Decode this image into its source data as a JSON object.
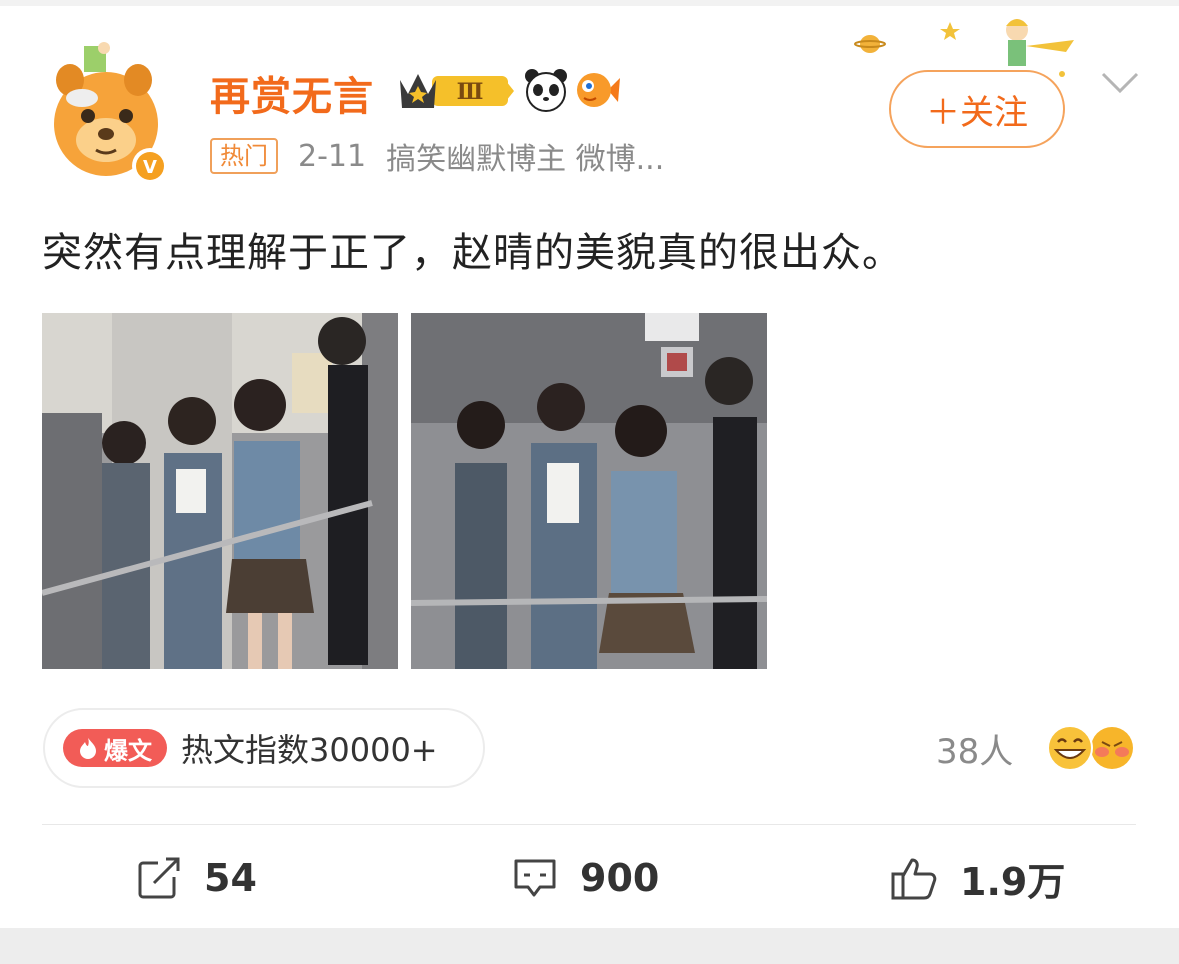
{
  "post": {
    "author_name": "再赏无言",
    "level_badge": "Ⅲ",
    "tag": "热门",
    "date": "2-11",
    "author_desc": "搞笑幽默博主 微博...",
    "verified_mark": "V",
    "follow_label": "＋关注",
    "text": "突然有点理解于正了，赵晴的美貌真的很出众。",
    "hot": {
      "badge": "爆文",
      "index_text": "热文指数30000+"
    },
    "likers_text": "38人",
    "actions": {
      "repost": "54",
      "comment": "900",
      "like": "1.9万"
    }
  },
  "icons": [
    "avatar-cartoon-bear",
    "crown-badge",
    "panda-icon",
    "fish-icon",
    "chevron-down-icon",
    "repost-icon",
    "comment-icon",
    "thumbs-up-icon",
    "grin-emoji",
    "blush-emoji"
  ],
  "colors": {
    "accent": "#f26a1b",
    "hot_badge": "#f25c57",
    "text": "#222222",
    "muted": "#8a8a8a"
  }
}
